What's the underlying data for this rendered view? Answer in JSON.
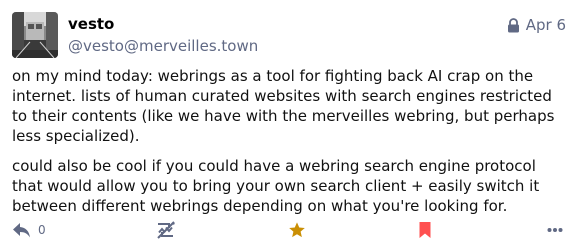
{
  "post": {
    "display_name": "vesto",
    "account": "@vesto@merveilles.town",
    "visibility_icon": "lock-icon",
    "date": "Apr 6",
    "paragraphs": [
      "on my mind today: webrings as a tool for fighting back AI crap on the internet. lists of human curated websites with search engines restricted to their contents (like we have with the merveilles webring, but perhaps less specialized).",
      "could also be cool if you could have a webring search engine protocol that would allow you to bring your own search client + easily switch it between different webrings depending on what you're looking for."
    ]
  },
  "actions": {
    "reply": {
      "icon": "reply-icon",
      "count": "0"
    },
    "boost": {
      "icon": "boost-disabled-icon"
    },
    "favourite": {
      "icon": "star-icon"
    },
    "bookmark": {
      "icon": "bookmark-icon"
    },
    "more": {
      "icon": "more-icon"
    }
  },
  "colors": {
    "muted": "#606984",
    "text": "#111111",
    "star": "#ca8f04",
    "bookmark": "#ff5050"
  }
}
